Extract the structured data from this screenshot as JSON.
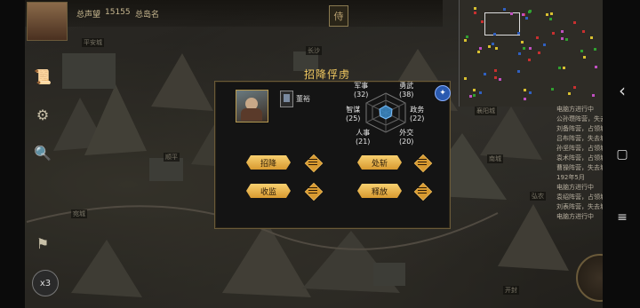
{
  "hud": {
    "prestige_label": "总声望",
    "prestige_value": "15155",
    "rank_label": "总岛名",
    "top_center_icon": "侍"
  },
  "sidebar": {
    "items": [
      {
        "icon": "scroll-icon"
      },
      {
        "icon": "gear-icon"
      },
      {
        "icon": "search-icon"
      },
      {
        "icon": "banner-icon"
      }
    ]
  },
  "map": {
    "labels": [
      "平安城",
      "长沙",
      "顺平",
      "襄阳城",
      "南城",
      "弘农",
      "开封",
      "宛城"
    ],
    "zoom": "x3"
  },
  "log": {
    "lines": [
      "电脑方进行中",
      "公孙瓒阵营，失去城市",
      "刘备阵营，占领城市",
      "吕布阵营，失去城市",
      "孙坚阵营，占领城市",
      "袁术阵营，占领城市",
      "曹操阵营，失去城市",
      "192年5月",
      "电脑方进行中",
      "袁绍阵营，占领城市",
      "刘表阵营，失去城市",
      "电脑方进行中"
    ]
  },
  "dialog": {
    "title": "招降俘虏",
    "general_name": "董裕",
    "stats": {
      "military": {
        "label": "军事",
        "value": "(32)"
      },
      "valor": {
        "label": "勇武",
        "value": "(38)"
      },
      "intellect": {
        "label": "智谋",
        "value": "(25)"
      },
      "politics": {
        "label": "政务",
        "value": "(22)"
      },
      "personnel": {
        "label": "人事",
        "value": "(21)"
      },
      "diplomacy": {
        "label": "外交",
        "value": "(20)"
      }
    },
    "actions": {
      "recruit": "招降",
      "execute": "处斩",
      "imprison": "收监",
      "release": "释放"
    }
  },
  "system_nav": {
    "back": "‹",
    "home": "▢",
    "menu": "≡"
  },
  "colors": {
    "accent": "#f0c860",
    "button": "#d89a30",
    "dialog_bg": "#141414"
  }
}
